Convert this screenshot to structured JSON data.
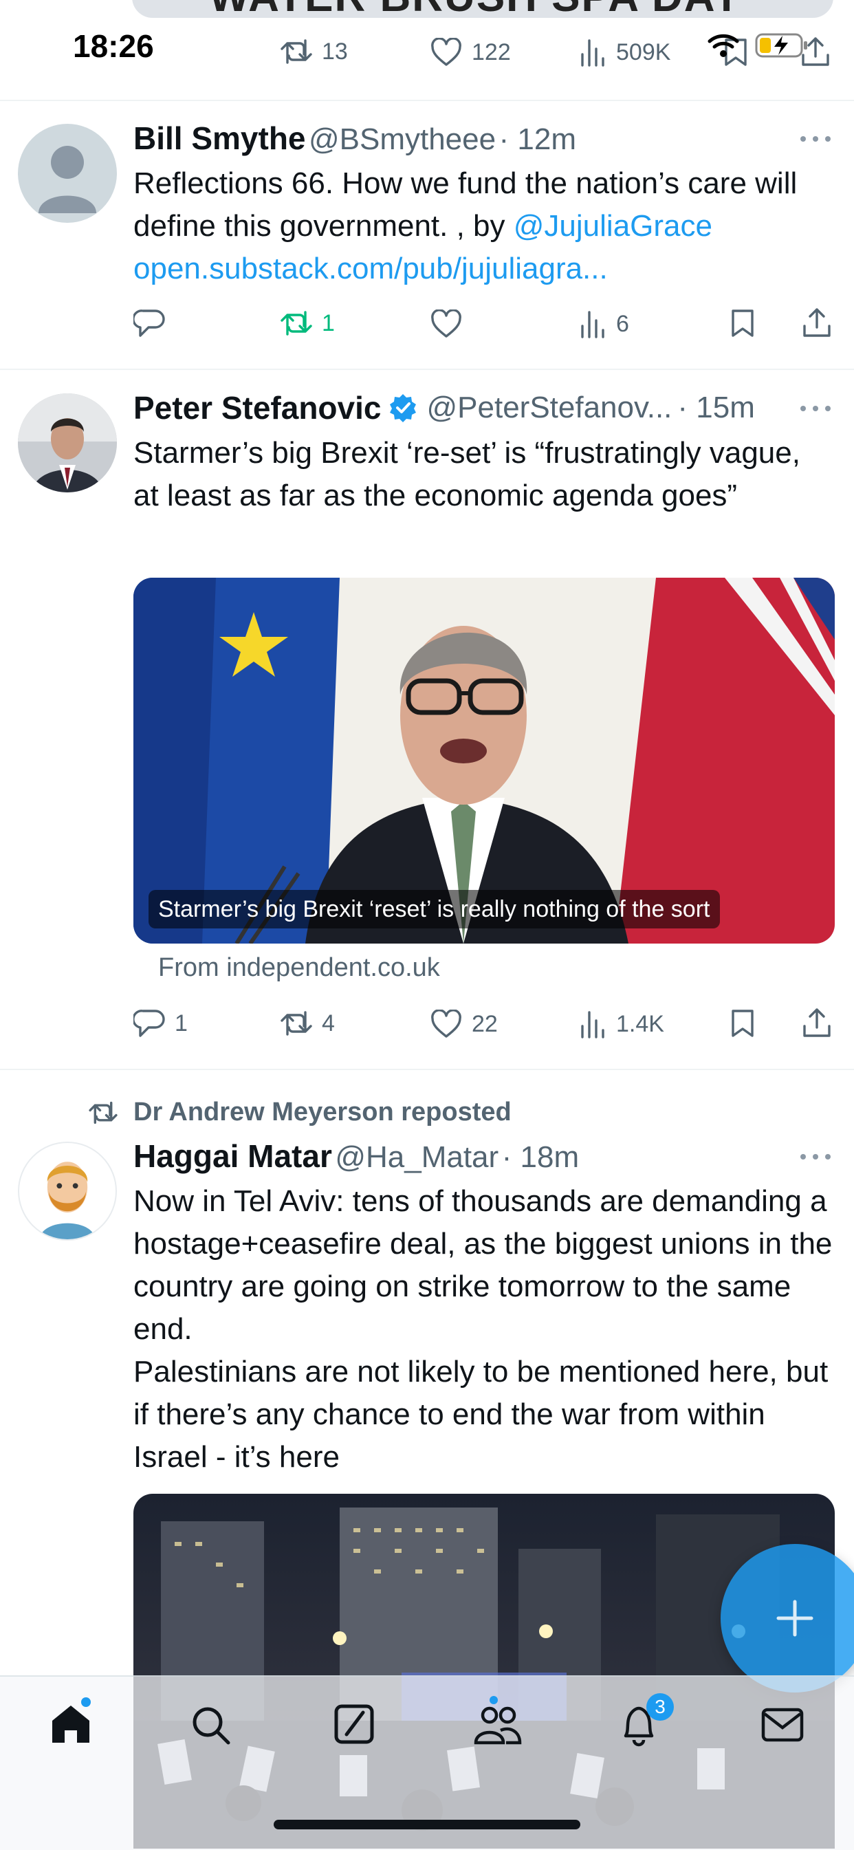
{
  "status_bar": {
    "time": "18:26"
  },
  "prev_post": {
    "banner_text": "WATER BRUSH SPA DAY",
    "retweets": "13",
    "likes": "122",
    "views": "509K"
  },
  "posts": [
    {
      "name": "Bill Smythe",
      "handle": "@BSmytheee",
      "time": "· 12m",
      "text": "Reflections 66. How we fund the nation’s care will define this government. , by",
      "mention": "@JujuliaGrace",
      "link": "open.substack.com/pub/jujuliagra...",
      "replies": "",
      "retweets": "1",
      "likes": "",
      "views": "6"
    },
    {
      "name": "Peter Stefanovic",
      "handle": "@PeterStefanov...",
      "time": "· 15m",
      "text": "Starmer’s big Brexit ‘re-set’ is “frustratingly vague, at least as far as the economic agenda goes”",
      "card_caption": "Starmer’s big Brexit ‘reset’ is really nothing of the sort",
      "card_source": "From independent.co.uk",
      "replies": "1",
      "retweets": "4",
      "likes": "22",
      "views": "1.4K"
    },
    {
      "reposted_by": "Dr Andrew Meyerson reposted",
      "name": "Haggai Matar",
      "handle": "@Ha_Matar",
      "time": "· 18m",
      "text_1": "Now in Tel Aviv: tens of thousands are demanding a hostage+ceasefire deal, as the biggest unions in the country are going on strike tomorrow to the same end.",
      "text_2": "Palestinians are not likely to be mentioned here, but if there’s any chance to end the war from within Israel - it’s here"
    }
  ],
  "bottom_nav": {
    "notifications_badge": "3"
  },
  "colors": {
    "accent": "#1d9bf0",
    "retweet_active": "#00ba7c",
    "icon_gray": "#536471",
    "text": "#0f1419"
  }
}
